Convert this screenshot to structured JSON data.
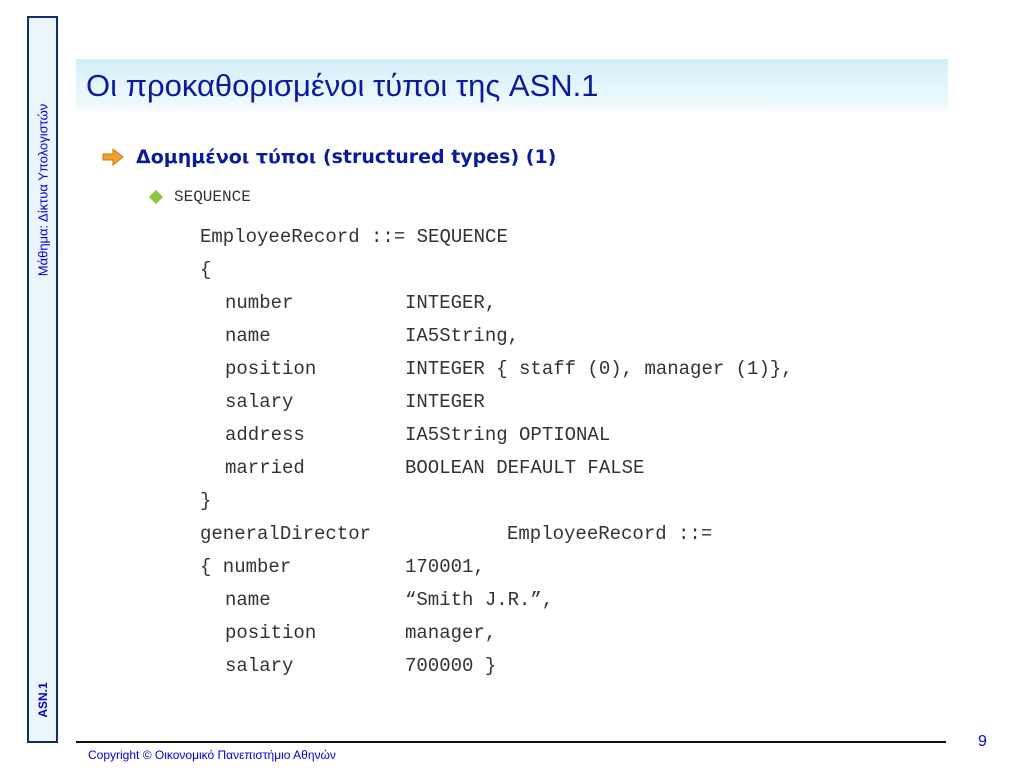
{
  "sidebar": {
    "course": "Μάθημα: Δίκτυα Υπολογιστών",
    "topic": "ASN.1"
  },
  "title": "Οι προκαθορισμένοι τύποι της ASN.1",
  "bullet1": {
    "icon": "arrow-right-icon",
    "text": "Δομημένοι τύποι (structured types) (1)"
  },
  "bullet2": {
    "icon": "diamond-icon",
    "text": "SEQUENCE"
  },
  "code": {
    "l1": "EmployeeRecord ::= SEQUENCE",
    "l2": "{",
    "f1": [
      "number",
      "INTEGER,"
    ],
    "f2": [
      "name",
      "IA5String,"
    ],
    "f3": [
      "position",
      "INTEGER { staff (0), manager (1)},"
    ],
    "f4": [
      "salary",
      "INTEGER"
    ],
    "f5": [
      "address",
      "IA5String OPTIONAL"
    ],
    "f6": [
      "married",
      "BOOLEAN DEFAULT FALSE"
    ],
    "l9": "}",
    "gd": [
      "generalDirector",
      "EmployeeRecord ::="
    ],
    "v1": [
      "{ number",
      "170001,"
    ],
    "v2": [
      "name",
      "“Smith J.R.”,"
    ],
    "v3": [
      "position",
      "manager,"
    ],
    "v4": [
      "salary",
      "700000 }"
    ]
  },
  "footer": {
    "copyright": "Copyright © Οικονομικό Πανεπιστήμιο Αθηνών",
    "page_number": "9"
  },
  "colors": {
    "title": "#0b1c9b",
    "accent_arrow": "#f0a030",
    "bullet_diamond": "#8cc63f",
    "sidebar_border": "#0f2f68",
    "footer_text": "#0000cc"
  }
}
